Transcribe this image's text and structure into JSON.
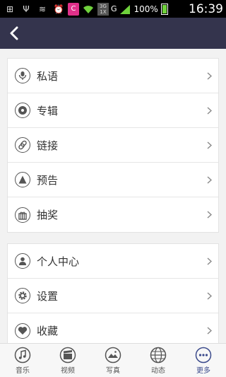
{
  "status_bar": {
    "network": "3G\n1X",
    "carrier_letter": "G",
    "battery": "100%",
    "time": "16:39"
  },
  "colors": {
    "nav_bg": "#34344d",
    "accent": "#3c4b8c"
  },
  "menu_group_1": [
    {
      "label": "私语",
      "icon": "microphone-icon"
    },
    {
      "label": "专辑",
      "icon": "disc-icon"
    },
    {
      "label": "链接",
      "icon": "link-icon"
    },
    {
      "label": "预告",
      "icon": "triangle-icon"
    },
    {
      "label": "抽奖",
      "icon": "gift-icon"
    }
  ],
  "menu_group_2": [
    {
      "label": "个人中心",
      "icon": "person-icon"
    },
    {
      "label": "设置",
      "icon": "gear-icon"
    },
    {
      "label": "收藏",
      "icon": "heart-icon"
    }
  ],
  "tabs": [
    {
      "label": "音乐",
      "icon": "music-note-icon"
    },
    {
      "label": "视频",
      "icon": "clapperboard-icon"
    },
    {
      "label": "写真",
      "icon": "photo-icon"
    },
    {
      "label": "动态",
      "icon": "globe-icon"
    },
    {
      "label": "更多",
      "icon": "more-icon",
      "active": true
    }
  ]
}
